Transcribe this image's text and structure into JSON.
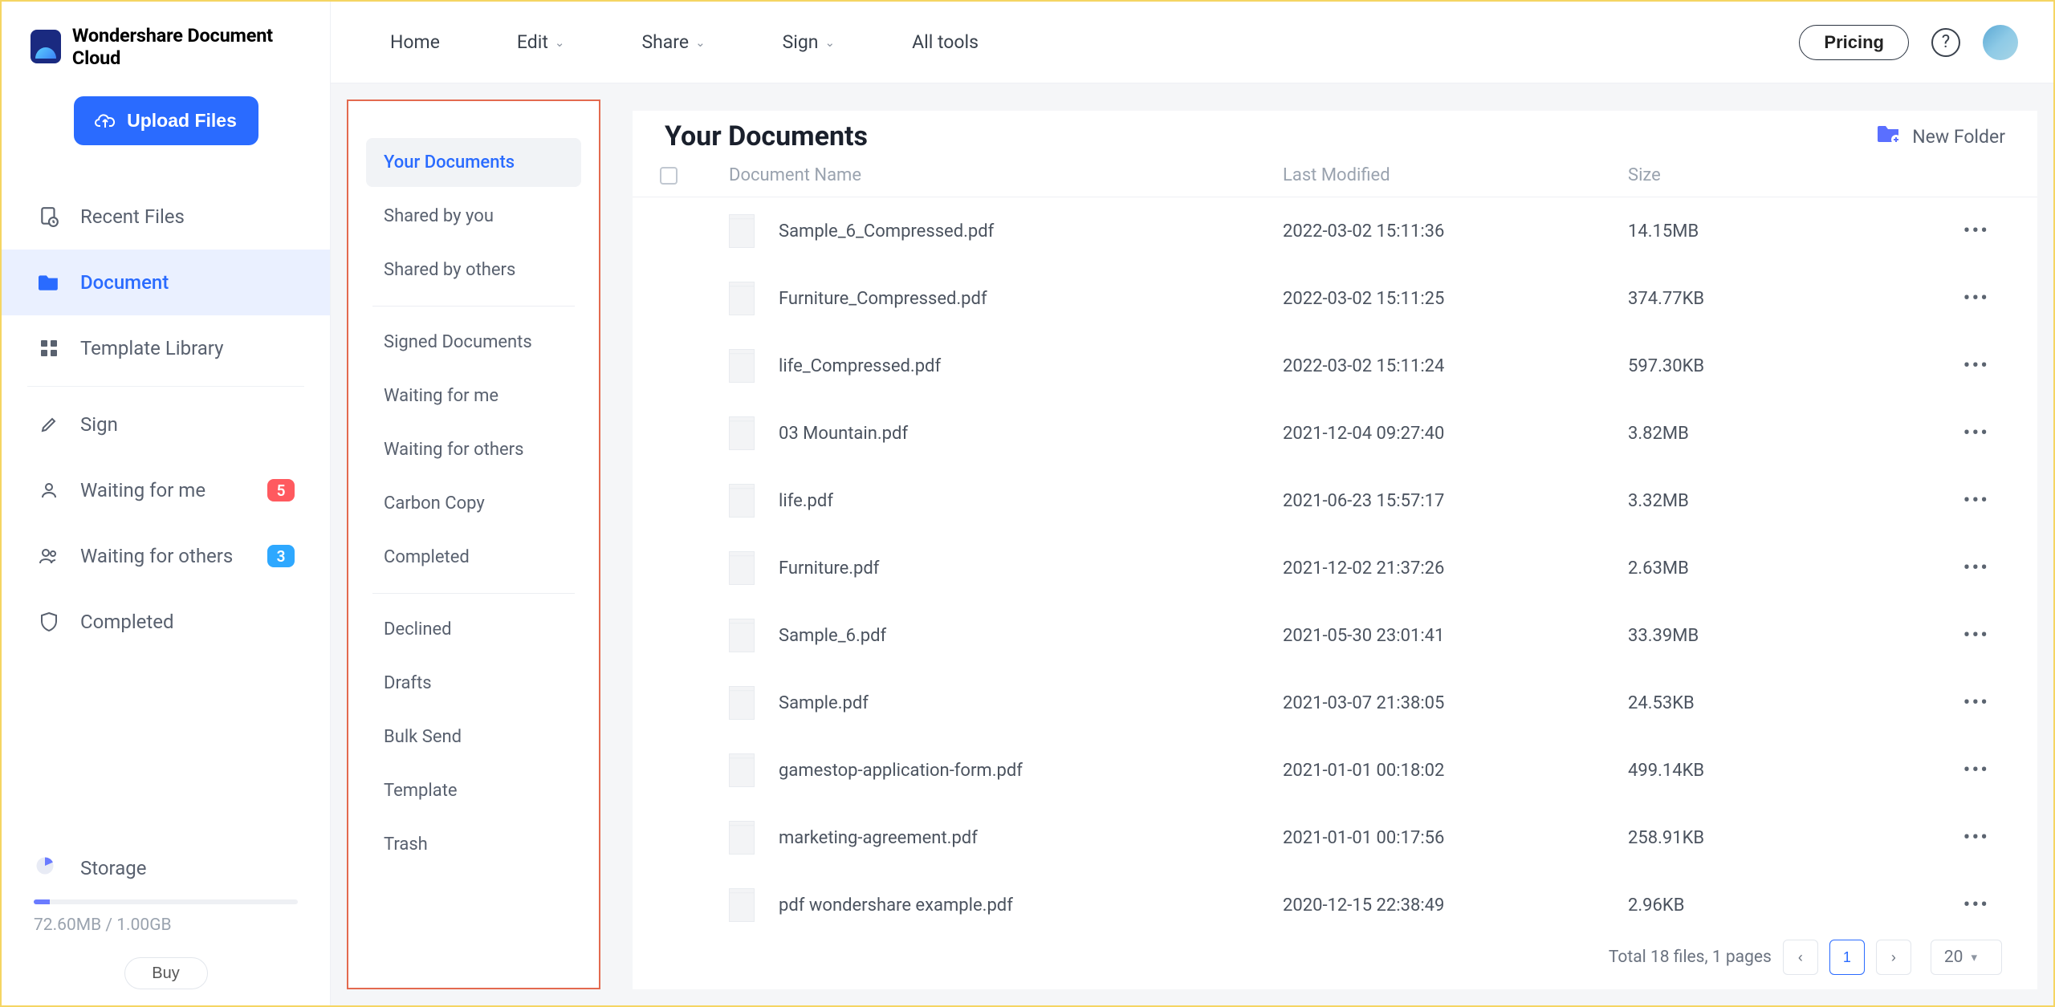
{
  "brand": {
    "name": "Wondershare Document Cloud"
  },
  "upload_label": "Upload Files",
  "sidebar": {
    "items": [
      {
        "label": "Recent Files",
        "icon": "clock-file-icon",
        "active": false
      },
      {
        "label": "Document",
        "icon": "folder-icon",
        "active": true
      },
      {
        "label": "Template Library",
        "icon": "grid-icon",
        "active": false
      }
    ],
    "items2": [
      {
        "label": "Sign",
        "icon": "pencil-icon"
      },
      {
        "label": "Waiting for me",
        "icon": "user-icon",
        "badge": "5",
        "badge_style": "red"
      },
      {
        "label": "Waiting for others",
        "icon": "users-icon",
        "badge": "3",
        "badge_style": "blue"
      },
      {
        "label": "Completed",
        "icon": "shield-icon"
      }
    ]
  },
  "storage": {
    "heading": "Storage",
    "used_text": "72.60MB / 1.00GB",
    "buy_label": "Buy"
  },
  "topnav": [
    {
      "label": "Home",
      "dropdown": false
    },
    {
      "label": "Edit",
      "dropdown": true
    },
    {
      "label": "Share",
      "dropdown": true
    },
    {
      "label": "Sign",
      "dropdown": true
    },
    {
      "label": "All tools",
      "dropdown": false
    }
  ],
  "pricing_label": "Pricing",
  "subside": {
    "group1": [
      {
        "label": "Your Documents",
        "active": true
      },
      {
        "label": "Shared by you"
      },
      {
        "label": "Shared by others"
      }
    ],
    "group2": [
      {
        "label": "Signed Documents"
      },
      {
        "label": "Waiting for me"
      },
      {
        "label": "Waiting for others"
      },
      {
        "label": "Carbon Copy"
      },
      {
        "label": "Completed"
      }
    ],
    "group3": [
      {
        "label": "Declined"
      },
      {
        "label": "Drafts"
      },
      {
        "label": "Bulk Send"
      },
      {
        "label": "Template"
      },
      {
        "label": "Trash"
      }
    ]
  },
  "main": {
    "title": "Your Documents",
    "new_folder_label": "New Folder",
    "columns": {
      "name": "Document Name",
      "modified": "Last Modified",
      "size": "Size"
    },
    "rows": [
      {
        "name": "Sample_6_Compressed.pdf",
        "date": "2022-03-02 15:11:36",
        "size": "14.15MB"
      },
      {
        "name": "Furniture_Compressed.pdf",
        "date": "2022-03-02 15:11:25",
        "size": "374.77KB"
      },
      {
        "name": "life_Compressed.pdf",
        "date": "2022-03-02 15:11:24",
        "size": "597.30KB"
      },
      {
        "name": "03 Mountain.pdf",
        "date": "2021-12-04 09:27:40",
        "size": "3.82MB"
      },
      {
        "name": "life.pdf",
        "date": "2021-06-23 15:57:17",
        "size": "3.32MB"
      },
      {
        "name": "Furniture.pdf",
        "date": "2021-12-02 21:37:26",
        "size": "2.63MB"
      },
      {
        "name": "Sample_6.pdf",
        "date": "2021-05-30 23:01:41",
        "size": "33.39MB"
      },
      {
        "name": "Sample.pdf",
        "date": "2021-03-07 21:38:05",
        "size": "24.53KB"
      },
      {
        "name": "gamestop-application-form.pdf",
        "date": "2021-01-01 00:18:02",
        "size": "499.14KB"
      },
      {
        "name": "marketing-agreement.pdf",
        "date": "2021-01-01 00:17:56",
        "size": "258.91KB"
      },
      {
        "name": "pdf wondershare example.pdf",
        "date": "2020-12-15 22:38:49",
        "size": "2.96KB"
      }
    ]
  },
  "footer": {
    "total_text": "Total 18 files, 1 pages",
    "current_page": "1",
    "page_size": "20"
  }
}
